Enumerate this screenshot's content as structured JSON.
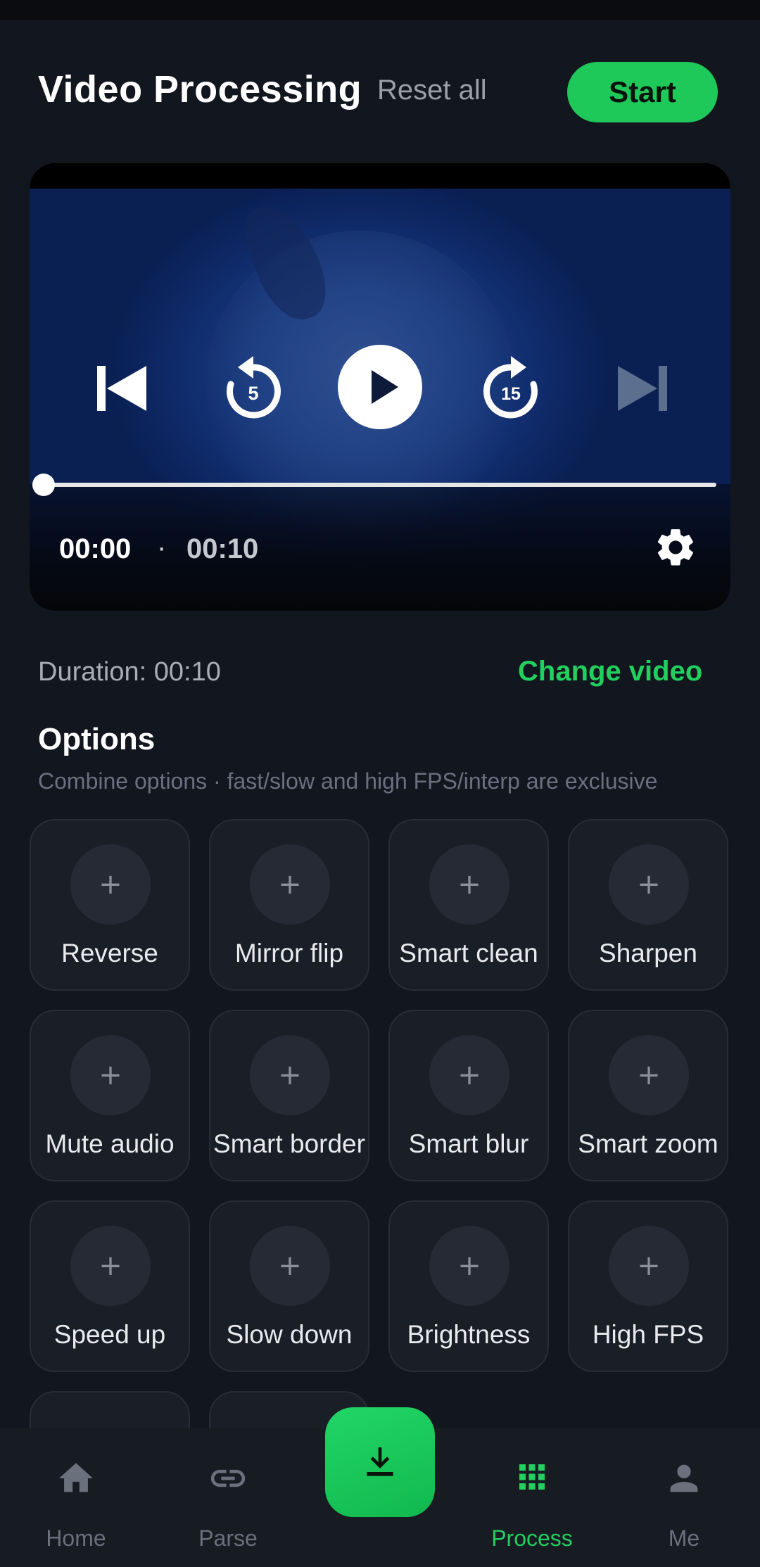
{
  "header": {
    "title": "Video Processing",
    "reset_label": "Reset all",
    "start_label": "Start"
  },
  "player": {
    "current_time": "00:00",
    "separator": "·",
    "total_time": "00:10",
    "progress": 0,
    "replay_seconds": "5",
    "forward_seconds": "15"
  },
  "info": {
    "duration": "Duration: 00:10",
    "change_video": "Change video"
  },
  "options": {
    "title": "Options",
    "subtitle": "Combine options · fast/slow and high FPS/interp are exclusive",
    "add_symbol": "+",
    "items": [
      {
        "label": "Reverse"
      },
      {
        "label": "Mirror flip"
      },
      {
        "label": "Smart clean"
      },
      {
        "label": "Sharpen"
      },
      {
        "label": "Mute audio"
      },
      {
        "label": "Smart border"
      },
      {
        "label": "Smart blur"
      },
      {
        "label": "Smart zoom"
      },
      {
        "label": "Speed up"
      },
      {
        "label": "Slow down"
      },
      {
        "label": "Brightness"
      },
      {
        "label": "High FPS"
      }
    ]
  },
  "nav": {
    "items": [
      {
        "label": "Home",
        "icon": "home-icon"
      },
      {
        "label": "Parse",
        "icon": "link-icon"
      },
      {
        "label": "Process",
        "icon": "grid-icon",
        "active": true
      },
      {
        "label": "Me",
        "icon": "person-icon"
      }
    ],
    "fab_icon": "download-icon"
  },
  "colors": {
    "accent": "#1ec95a",
    "background": "#12161e",
    "tile": "#1a1f27"
  }
}
